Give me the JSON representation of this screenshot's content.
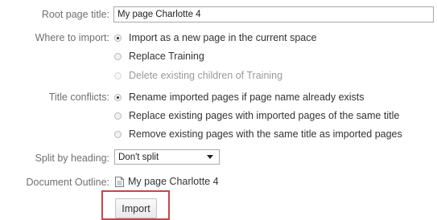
{
  "form": {
    "root_title_label": "Root page title:",
    "root_title_value": "My page Charlotte 4",
    "where_label": "Where to import:",
    "where_options": [
      {
        "label": "Import as a new page in the current space",
        "checked": true,
        "disabled": false
      },
      {
        "label": "Replace Training",
        "checked": false,
        "disabled": false
      },
      {
        "label": "Delete existing children of Training",
        "checked": false,
        "disabled": true
      }
    ],
    "conflicts_label": "Title conflicts:",
    "conflict_options": [
      {
        "label": "Rename imported pages if page name already exists",
        "checked": true
      },
      {
        "label": "Replace existing pages with imported pages of the same title",
        "checked": false
      },
      {
        "label": "Remove existing pages with the same title as imported pages",
        "checked": false
      }
    ],
    "split_label": "Split by heading:",
    "split_value": "Don't split",
    "outline_label": "Document Outline:",
    "outline_item": "My page Charlotte 4",
    "import_button": "Import"
  },
  "colors": {
    "label_gray": "#707070",
    "highlight_border": "#c8454a"
  },
  "icons": {
    "outline_item": "document-icon",
    "split_dropdown": "chevron-down-icon"
  }
}
